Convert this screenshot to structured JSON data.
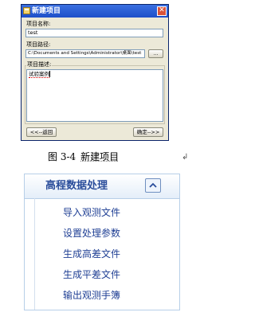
{
  "dialog": {
    "title": "新建项目",
    "close_glyph": "✕",
    "name_label": "项目名称:",
    "name_value": "test",
    "path_label": "项目路径:",
    "path_value": "C:\\Documents and Settings\\Administrator\\桌面\\test",
    "browse_label": "...",
    "desc_label": "项目描述:",
    "desc_value": "试验案例",
    "back_button": "<<--返回",
    "confirm_button": "确定-->>"
  },
  "caption": {
    "figure_number": "图 3-4",
    "figure_title": "新建项目",
    "paragraph_mark": "↲"
  },
  "panel": {
    "title": "高程数据处理",
    "toggle_icon": "chevron-up-icon",
    "items": [
      "导入观测文件",
      "设置处理参数",
      "生成高差文件",
      "生成平差文件",
      "输出观测手簿"
    ]
  },
  "colors": {
    "titlebar": "#2b5fd6",
    "close": "#d9533a",
    "panel_text": "#1f3f94",
    "panel_border": "#b7cfe8"
  }
}
